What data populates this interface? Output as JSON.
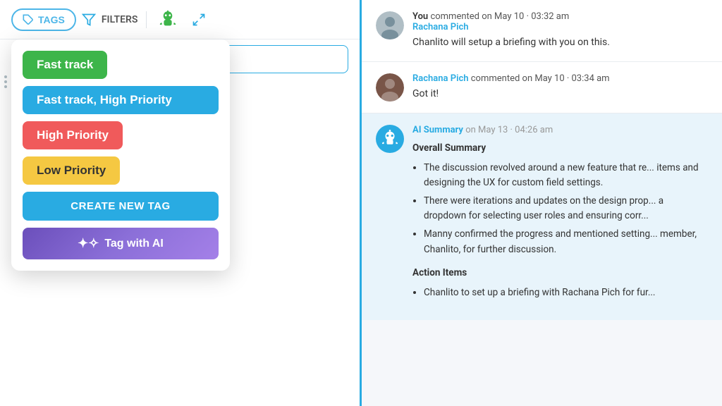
{
  "toolbar": {
    "tags_label": "TAGS",
    "filters_label": "FILTERS"
  },
  "dropdown": {
    "fast_track_label": "Fast track",
    "fast_track_high_label": "Fast track, High Priority",
    "high_priority_label": "High Priority",
    "low_priority_label": "Low Priority",
    "create_new_tag_label": "CREATE NEW TAG",
    "tag_with_ai_label": "Tag with AI"
  },
  "comments": [
    {
      "author": "You",
      "action": "commented on",
      "timestamp": "May 10 · 03:32 am",
      "name_link": "Rachana Pich",
      "text": "Chanlito will setup a briefing with you on this."
    },
    {
      "author": "Rachana Pich",
      "action": "commented on",
      "timestamp": "May 10 · 03:34 am",
      "text": "Got it!"
    }
  ],
  "ai_summary": {
    "label": "AI Summary",
    "timestamp": "on May 13 · 04:26 am",
    "overall_title": "Overall Summary",
    "bullets": [
      "The discussion revolved around a new feature that re... items and designing the UX for custom field settings.",
      "There were iterations and updates on the design prop... a dropdown for selecting user roles and ensuring corr...",
      "Manny confirmed the progress and mentioned setting... member, Chanlito, for further discussion."
    ],
    "action_title": "Action Items",
    "action_bullets": [
      "Chanlito to set up a briefing with Rachana Pich for fur..."
    ]
  }
}
